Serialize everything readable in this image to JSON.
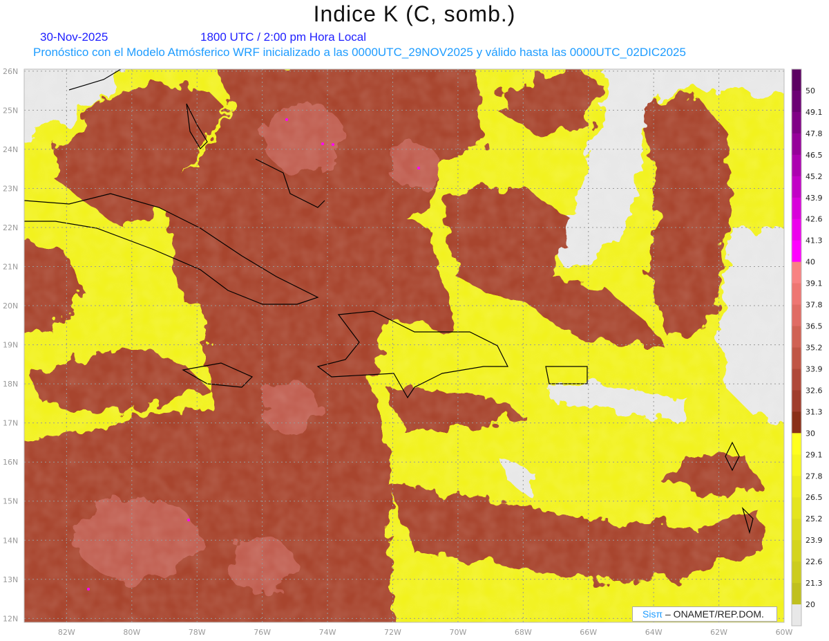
{
  "header": {
    "title": "Indice K (C, somb.)",
    "date": "30-Nov-2025",
    "time": "1800 UTC / 2:00 pm Hora Local",
    "subtitle": "Pronóstico con el Modelo Atmósferico WRF inicializado a las 0000UTC_29NOV2025 y válido hasta las  0000UTC_02DIC2025"
  },
  "map": {
    "lon_range": [
      -83.3,
      -60
    ],
    "lat_range": [
      11.9,
      26.05
    ],
    "lat_labels": [
      "26N",
      "25N",
      "24N",
      "23N",
      "22N",
      "21N",
      "20N",
      "19N",
      "18N",
      "17N",
      "16N",
      "15N",
      "14N",
      "13N",
      "12N"
    ],
    "lon_labels": [
      "82W",
      "80W",
      "78W",
      "76W",
      "74W",
      "72W",
      "70W",
      "68W",
      "66W",
      "64W",
      "62W",
      "60W"
    ],
    "grid": true
  },
  "colorbar": {
    "labels": [
      "50",
      "49.1",
      "47.8",
      "46.5",
      "45.2",
      "43.9",
      "42.6",
      "41.3",
      "40",
      "39.1",
      "37.8",
      "36.5",
      "35.2",
      "33.9",
      "32.6",
      "31.3",
      "30",
      "29.1",
      "27.8",
      "26.5",
      "25.2",
      "23.9",
      "22.6",
      "21.3",
      "20"
    ],
    "colors": [
      "#5c0062",
      "#6c0074",
      "#800086",
      "#96009a",
      "#ac00b0",
      "#c200c6",
      "#d800da",
      "#ec00ec",
      "#ff00ff",
      "#f88282",
      "#ee7672",
      "#e06c64",
      "#d06254",
      "#c05646",
      "#b04a3a",
      "#a03e2c",
      "#8a3018",
      "#ffff1e",
      "#f6f61e",
      "#ecec1e",
      "#e4e41e",
      "#dcdc1e",
      "#d4d41e",
      "#cccc1e",
      "#c0c01e",
      "#e8e8e8"
    ]
  },
  "footer": {
    "logo_sis": "Sisπ",
    "logo_org": "– ONAMET/REP.DOM."
  }
}
